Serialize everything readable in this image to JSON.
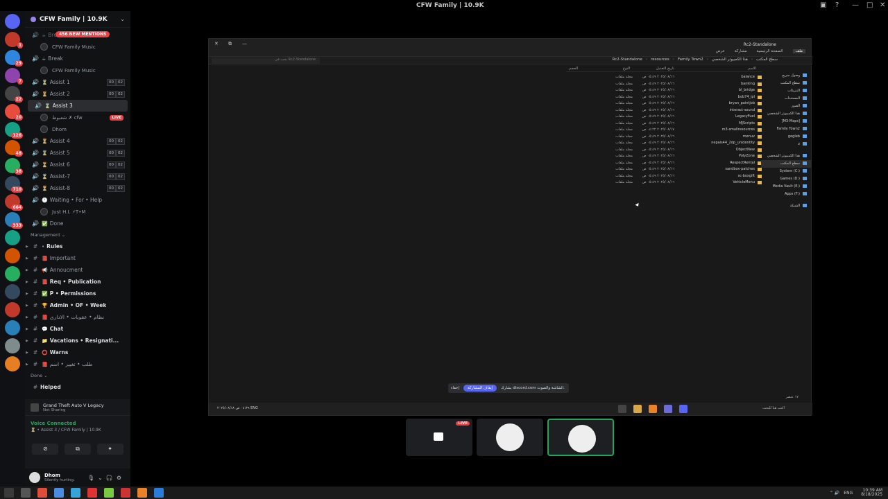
{
  "window": {
    "title": "CFW Family | 10.9K"
  },
  "server": {
    "name": "CFW Family | 10.9K",
    "mentions": "456 NEW MENTIONS"
  },
  "rail_badges": [
    "1",
    "29",
    "7",
    "22",
    "20",
    "126",
    "48",
    "38",
    "710",
    "664",
    "333"
  ],
  "channels_top": [
    {
      "type": "voice",
      "emoji": "☕",
      "label": "Break",
      "faded": true
    },
    {
      "type": "sub",
      "label": "CFW Family Music"
    },
    {
      "type": "voice",
      "emoji": "☕",
      "label": "Break"
    },
    {
      "type": "sub",
      "label": "CFW Family Music"
    },
    {
      "type": "voice",
      "emoji": "⏳",
      "label": "Assist 1",
      "count": [
        "00",
        "02"
      ]
    },
    {
      "type": "voice",
      "emoji": "⏳",
      "label": "Assist 2",
      "count": [
        "00",
        "02"
      ]
    },
    {
      "type": "voice",
      "emoji": "⏳",
      "label": "Assist 3",
      "active": true
    }
  ],
  "assist3_users": [
    {
      "name": "شعبوط ✗ cfw",
      "live": "LIVE"
    },
    {
      "name": "Dhom"
    }
  ],
  "channels_mid": [
    {
      "label": "Assist 4",
      "count": [
        "00",
        "02"
      ]
    },
    {
      "label": "Assist 5",
      "count": [
        "00",
        "02"
      ]
    },
    {
      "label": "Assist 6",
      "count": [
        "00",
        "02"
      ]
    },
    {
      "label": "Assist-7",
      "count": [
        "00",
        "02"
      ]
    },
    {
      "label": "Assist-8",
      "count": [
        "00",
        "02"
      ]
    }
  ],
  "waiting": {
    "label": "Waiting • For • Help",
    "user": "Just H.I. ⚡T•M"
  },
  "done_voice": "Done",
  "category_management": "Management",
  "text_channels": [
    {
      "emoji": "•",
      "label": "Rules",
      "bold": true
    },
    {
      "emoji": "📕",
      "label": "Important"
    },
    {
      "emoji": "📢",
      "label": "Annoucment"
    },
    {
      "emoji": "📕",
      "label": "Req • Publication",
      "bold": true
    },
    {
      "emoji": "✅",
      "label": "P • Permissions",
      "bold": true
    },
    {
      "emoji": "🏆",
      "label": "Admin • OF • Week",
      "bold": true
    },
    {
      "emoji": "📕",
      "label": "نظام • عقوبات • الادارى"
    },
    {
      "emoji": "💬",
      "label": "Chat",
      "bold": true
    },
    {
      "emoji": "📁",
      "label": "Vacations • Resignati...",
      "bold": true
    },
    {
      "emoji": "⭕",
      "label": "Warns",
      "bold": true
    },
    {
      "emoji": "📕",
      "label": "طلب • تغيير • اسم"
    }
  ],
  "category_done": "Done",
  "helped": "Helped",
  "game_activity": {
    "title": "Grand Theft Auto V Legacy",
    "status": "Not Sharing"
  },
  "voice_connected": {
    "status": "Voice Connected",
    "channel": "⏳ • Assist 3 / CFW Family | 10.9K"
  },
  "user": {
    "name": "Dhom",
    "status": "Silently hurting."
  },
  "explorer": {
    "title": "Rc2-Standalone",
    "menu": [
      "ملف",
      "الصفحة الرئيسية",
      "مشاركة",
      "عرض"
    ],
    "search_placeholder": "بحث في Rc2-Standalone",
    "breadcrumbs": [
      "هذا الكمبيوتر الشخصي",
      "سطح المكتب",
      "Family Town2",
      "resources",
      "Rc2-Standalone"
    ],
    "columns": {
      "name": "الاسم",
      "date": "تاريخ التعديل",
      "type": "النوع",
      "size": "الحجم"
    },
    "files": [
      {
        "name": "balance",
        "date": "٢٠٢٥/٠٨/١٦ ٠٥:٤٩ ص",
        "type": "مجلد ملفات"
      },
      {
        "name": "banking",
        "date": "٢٠٢٥/٠٨/١٦ ٠٥:٤٩ ص",
        "type": "مجلد ملفات"
      },
      {
        "name": "bl_bridge",
        "date": "٢٠٢٥/٠٨/١٦ ٠٥:٤٩ ص",
        "type": "مجلد ملفات"
      },
      {
        "name": "bob74_ipl",
        "date": "٢٠٢٥/٠٨/١٦ ٠٥:٤٩ ص",
        "type": "مجلد ملفات"
      },
      {
        "name": "bryan_paintjob",
        "date": "٢٠٢٥/٠٨/١٦ ٠٥:٤٩ ص",
        "type": "مجلد ملفات"
      },
      {
        "name": "interact-sound",
        "date": "٢٠٢٥/٠٨/١٦ ٠٥:٤٩ ص",
        "type": "مجلد ملفات"
      },
      {
        "name": "LegacyFuel",
        "date": "٢٠٢٥/٠٨/١٦ ٠٥:٤٩ ص",
        "type": "مجلد ملفات"
      },
      {
        "name": "MJScripts",
        "date": "٢٠٢٥/٠٨/١٦ ٠٥:٤٩ ص",
        "type": "مجلد ملفات"
      },
      {
        "name": "m3-smallresources",
        "date": "٢٠٢٥/٠٨/١٧ ٠٤:٢٢ ص",
        "type": "مجلد ملفات"
      },
      {
        "name": "menuv",
        "date": "٢٠٢٥/٠٨/١٦ ٠٥:٤٩ ص",
        "type": "مجلد ملفات"
      },
      {
        "name": "nepais44_2dp_unidentity",
        "date": "٢٠٢٥/٠٨/١٦ ٠٥:٤٩ ص",
        "type": "مجلد ملفات"
      },
      {
        "name": "ObjectNew",
        "date": "٢٠٢٥/٠٨/١٦ ٠٥:٤٩ ص",
        "type": "مجلد ملفات"
      },
      {
        "name": "PolyZone",
        "date": "٢٠٢٥/٠٨/١٦ ٠٥:٤٩ ص",
        "type": "مجلد ملفات"
      },
      {
        "name": "RespectRental",
        "date": "٢٠٢٥/٠٨/١٦ ٠٥:٤٩ ص",
        "type": "مجلد ملفات"
      },
      {
        "name": "sandbox-patches",
        "date": "٢٠٢٥/٠٨/١٦ ٠٥:٤٩ ص",
        "type": "مجلد ملفات"
      },
      {
        "name": "sc-boxgift",
        "date": "٢٠٢٥/٠٨/١٦ ٠٥:٤٩ ص",
        "type": "مجلد ملفات"
      },
      {
        "name": "VehicleMenu",
        "date": "٢٠٢٥/٠٨/١٦ ٠٥:٤٩ ص",
        "type": "مجلد ملفات"
      }
    ],
    "nav": [
      "وصول سريع",
      "سطح المكتب",
      "التنزيلات",
      "المستندات",
      "الصور",
      "هذا الكمبيوتر الشخصي",
      "[M3-Maps]",
      "Family Town2",
      "gegleb",
      "z",
      "",
      "هذا الكمبيوتر الشخصي",
      "سطح المكتب",
      "System (C:)",
      "Games (D:)",
      "Media Vault (E:)",
      "Apps (F:)",
      "",
      "الشبكة"
    ],
    "status": "١٧ عنصر",
    "share_bar": {
      "text": "يشارك discord.com الشاشة والصوت.",
      "stop": "إيقاف المشاركة",
      "hide": "إخفاء"
    },
    "taskbar_search": "اكتب هنا للبحث",
    "taskbar_time": "٠٤:٣٩ ص",
    "taskbar_date": "٢٠٢٥/٠٨/١٨",
    "taskbar_lang": "ENG"
  },
  "stream_tiles": [
    {
      "live": "LIVE"
    },
    {},
    {
      "selected": true
    }
  ],
  "taskbar": {
    "lang": "ENG",
    "time": "10:39 AM",
    "date": "8/18/2025"
  }
}
